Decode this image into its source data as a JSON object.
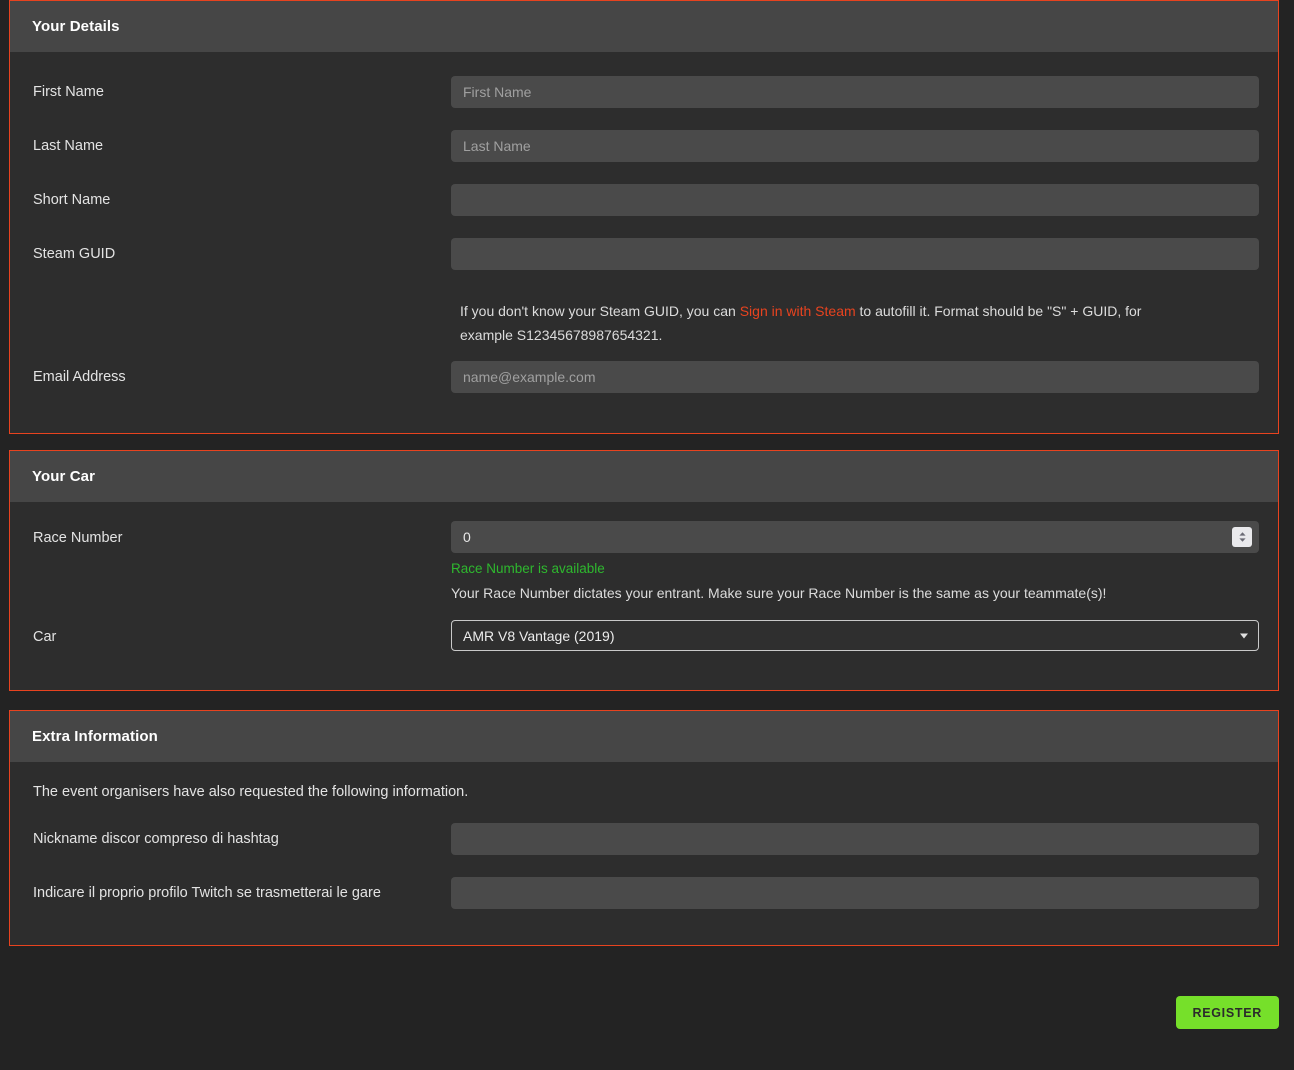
{
  "panels": {
    "details": {
      "title": "Your Details",
      "fields": [
        {
          "label": "First Name",
          "placeholder": "First Name",
          "value": ""
        },
        {
          "label": "Last Name",
          "placeholder": "Last Name",
          "value": ""
        },
        {
          "label": "Short Name",
          "placeholder": "",
          "value": ""
        },
        {
          "label": "Steam GUID",
          "placeholder": "",
          "value": ""
        },
        {
          "label": "Email Address",
          "placeholder": "name@example.com",
          "value": ""
        }
      ],
      "steam_help": {
        "before": "If you don't know your Steam GUID, you can ",
        "link": "Sign in with Steam",
        "after": " to autofill it. Format should be \"S\" + GUID, for example S12345678987654321."
      }
    },
    "car": {
      "title": "Your Car",
      "race_number": {
        "label": "Race Number",
        "value": "0",
        "availability": "Race Number is available",
        "hint": "Your Race Number dictates your entrant. Make sure your Race Number is the same as your teammate(s)!"
      },
      "car_select": {
        "label": "Car",
        "selected": "AMR V8 Vantage (2019)"
      }
    },
    "extra": {
      "title": "Extra Information",
      "intro": "The event organisers have also requested the following information.",
      "fields": [
        {
          "label": "Nickname discor compreso di hashtag",
          "placeholder": "",
          "value": ""
        },
        {
          "label": "Indicare il proprio profilo Twitch se trasmetterai le gare",
          "placeholder": "",
          "value": ""
        }
      ]
    }
  },
  "actions": {
    "register_label": "REGISTER"
  },
  "colors": {
    "panel_border": "#e8431f",
    "link": "#e8431f",
    "success": "#2eb82e",
    "register_bg": "#76e02a",
    "panel_header_bg": "#464646",
    "panel_body_bg": "#2d2d2d",
    "page_bg": "#232323",
    "input_bg": "#4a4a4a"
  }
}
